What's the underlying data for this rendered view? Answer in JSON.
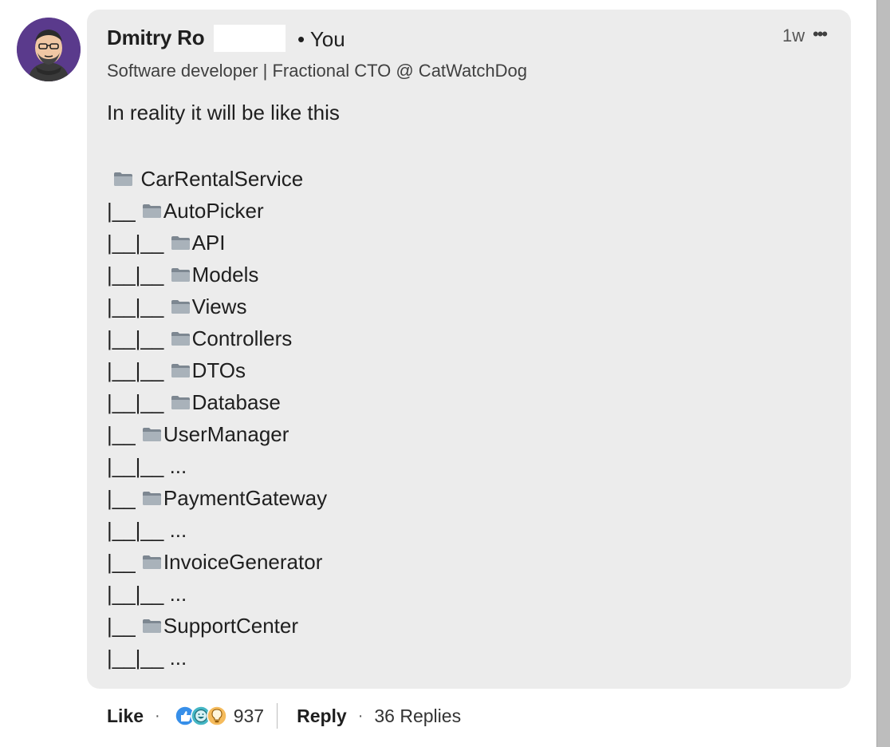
{
  "comment": {
    "author_name": "Dmitry Ro",
    "you_label": "• You",
    "headline": "Software developer | Fractional CTO @ CatWatchDog",
    "time": "1w",
    "more_label": "•••",
    "text": "In reality it will be like this",
    "tree": [
      {
        "prefix": " ",
        "folder": true,
        "name": " CarRentalService"
      },
      {
        "prefix": "|__ ",
        "folder": true,
        "name": "AutoPicker"
      },
      {
        "prefix": "|__|__ ",
        "folder": true,
        "name": "API"
      },
      {
        "prefix": "|__|__ ",
        "folder": true,
        "name": "Models"
      },
      {
        "prefix": "|__|__ ",
        "folder": true,
        "name": "Views"
      },
      {
        "prefix": "|__|__ ",
        "folder": true,
        "name": "Controllers"
      },
      {
        "prefix": "|__|__ ",
        "folder": true,
        "name": "DTOs"
      },
      {
        "prefix": "|__|__ ",
        "folder": true,
        "name": "Database"
      },
      {
        "prefix": "|__ ",
        "folder": true,
        "name": "UserManager"
      },
      {
        "prefix": "|__|__ ...",
        "folder": false,
        "name": ""
      },
      {
        "prefix": "|__ ",
        "folder": true,
        "name": "PaymentGateway"
      },
      {
        "prefix": "|__|__ ...",
        "folder": false,
        "name": ""
      },
      {
        "prefix": "|__ ",
        "folder": true,
        "name": "InvoiceGenerator"
      },
      {
        "prefix": "|__|__ ...",
        "folder": false,
        "name": ""
      },
      {
        "prefix": "|__ ",
        "folder": true,
        "name": "SupportCenter"
      },
      {
        "prefix": "|__|__ ...",
        "folder": false,
        "name": ""
      }
    ]
  },
  "actions": {
    "like_label": "Like",
    "separator": "·",
    "reaction_icons": [
      "like-icon",
      "funny-icon",
      "insightful-icon"
    ],
    "reaction_count": "937",
    "reply_label": "Reply",
    "replies_label": "36 Replies"
  },
  "colors": {
    "bubble_bg": "#ececec",
    "avatar_bg": "#5a3a8c",
    "like_blue": "#378fe9",
    "funny_teal": "#44b6c4",
    "insightful_yellow": "#f5bb5c"
  }
}
